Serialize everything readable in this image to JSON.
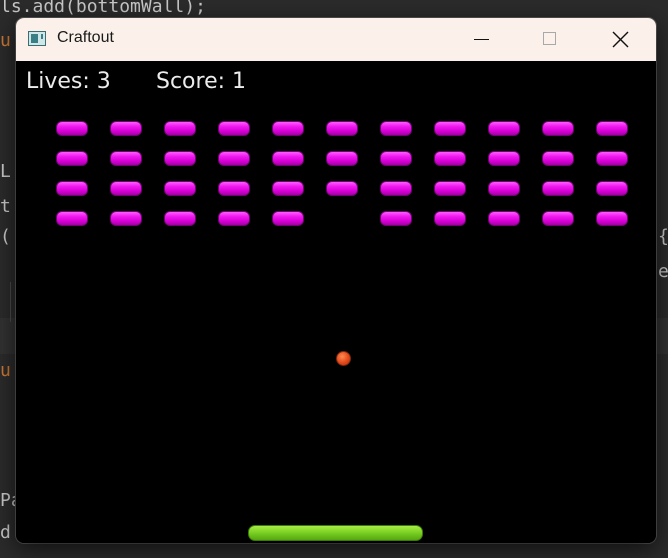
{
  "editor": {
    "lines": [
      {
        "text": "ls.add(bottomWall);",
        "accent": ""
      },
      {
        "text": "",
        "accent": "u"
      },
      {
        "text": "L",
        "accent": ""
      },
      {
        "text": "t",
        "accent": ""
      },
      {
        "text": "(",
        "accent": ""
      },
      {
        "text": "",
        "accent": "u"
      },
      {
        "text": "Pa",
        "accent": ""
      },
      {
        "text": "d",
        "accent": ""
      },
      {
        "text": "{",
        "accent": ""
      },
      {
        "text": "e",
        "accent": ""
      }
    ]
  },
  "window": {
    "title": "Craftout",
    "icon": "app-window-icon",
    "buttons": {
      "minimize": "minimize-icon",
      "maximize": "maximize-icon",
      "close": "close-icon"
    }
  },
  "hud": {
    "lives_text": "Lives: 3",
    "score_text": "Score: 1",
    "lives": 3,
    "score": 1
  },
  "game": {
    "brick_rows": [
      [
        true,
        true,
        true,
        true,
        true,
        true,
        true,
        true,
        true,
        true,
        true
      ],
      [
        true,
        true,
        true,
        true,
        true,
        true,
        true,
        true,
        true,
        true,
        true
      ],
      [
        true,
        true,
        true,
        true,
        true,
        true,
        true,
        true,
        true,
        true,
        true
      ],
      [
        true,
        true,
        true,
        true,
        true,
        false,
        true,
        true,
        true,
        true,
        true
      ]
    ],
    "colors": {
      "brick": "#e010e0",
      "ball": "#e4481a",
      "paddle": "#7cd224",
      "background": "#000000"
    }
  }
}
